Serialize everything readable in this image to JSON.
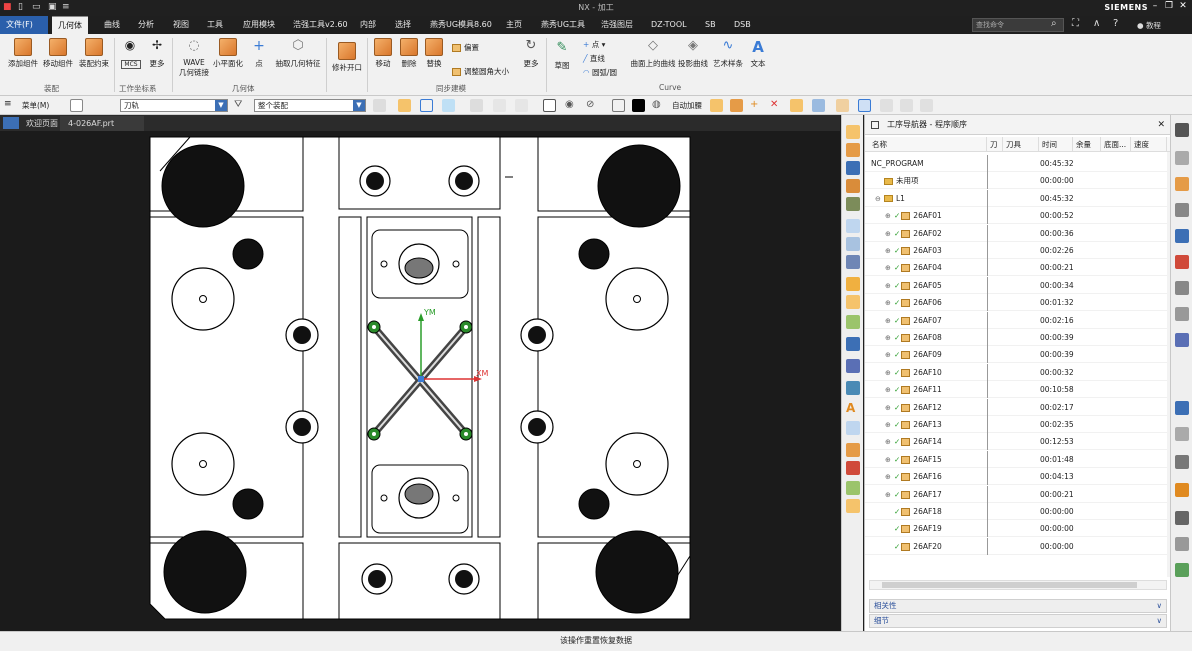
{
  "window": {
    "title": "NX - 加工",
    "brand": "SIEMENS"
  },
  "tabs": [
    {
      "label": "文件(F)"
    },
    {
      "label": "几何体"
    },
    {
      "label": "曲线"
    },
    {
      "label": "分析"
    },
    {
      "label": "视图"
    },
    {
      "label": "工具"
    },
    {
      "label": "应用模块"
    },
    {
      "label": "浩强工具v2.60"
    },
    {
      "label": "内部"
    },
    {
      "label": "选择"
    },
    {
      "label": "燕秀UG模具8.60"
    },
    {
      "label": "主页"
    },
    {
      "label": "燕秀UG工具"
    },
    {
      "label": "浩强图层"
    },
    {
      "label": "DZ-TOOL"
    },
    {
      "label": "SB"
    },
    {
      "label": "DSB"
    }
  ],
  "search": {
    "placeholder": "查找命令"
  },
  "user": {
    "label": "教程"
  },
  "ribbon": {
    "add_component": "添加组件",
    "move_component": "移动组件",
    "assembly_constraints": "装配约束",
    "group_assembly": "装配",
    "more1": "更多",
    "mcs": "MCS",
    "group_wcs": "工作坐标系",
    "wave_line1": "WAVE",
    "wave_line2": "几何链接",
    "small_planar": "小平面化",
    "point": "点",
    "extract_geom": "抽取几何特征",
    "group_geometry": "几何体",
    "patch_opening": "修补开口",
    "move": "移动",
    "delete": "删除",
    "replace": "替换",
    "offset": "偏置",
    "resize_blend": "调整圆角大小",
    "more2": "更多",
    "group_sync": "同步建模",
    "sketch": "草图",
    "point2": "点",
    "line": "直线",
    "arc": "圆弧/圆",
    "curve_on_surface": "曲面上的曲线",
    "project_curve": "投影曲线",
    "studio_spline": "艺术样条",
    "text": "文本",
    "group_curve": "Curve"
  },
  "toolbar2": {
    "menu": "菜单(M)",
    "filter_value": "刀轨",
    "scope_value": "整个装配",
    "auto_judge": "自动加腰"
  },
  "doc_tabs": [
    {
      "label": "欢迎页面"
    },
    {
      "label": "4-026AF.prt"
    }
  ],
  "axes": {
    "y": "YM",
    "x": "XM"
  },
  "navigator": {
    "title": "工序导航器 - 程序顺序",
    "columns": [
      "名称",
      "刀",
      "刀具",
      "时间",
      "余量",
      "底面...",
      "速度"
    ],
    "rows": [
      {
        "name": "NC_PROGRAM",
        "time": "00:45:32",
        "level": 0,
        "type": "root"
      },
      {
        "name": "未用项",
        "time": "00:00:00",
        "level": 1,
        "type": "folder"
      },
      {
        "name": "L1",
        "time": "00:45:32",
        "level": 1,
        "type": "folder"
      },
      {
        "name": "26AF01",
        "time": "00:00:52",
        "level": 2,
        "type": "op"
      },
      {
        "name": "26AF02",
        "time": "00:00:36",
        "level": 2,
        "type": "op"
      },
      {
        "name": "26AF03",
        "time": "00:02:26",
        "level": 2,
        "type": "op"
      },
      {
        "name": "26AF04",
        "time": "00:00:21",
        "level": 2,
        "type": "op"
      },
      {
        "name": "26AF05",
        "time": "00:00:34",
        "level": 2,
        "type": "op"
      },
      {
        "name": "26AF06",
        "time": "00:01:32",
        "level": 2,
        "type": "op"
      },
      {
        "name": "26AF07",
        "time": "00:02:16",
        "level": 2,
        "type": "op"
      },
      {
        "name": "26AF08",
        "time": "00:00:39",
        "level": 2,
        "type": "op"
      },
      {
        "name": "26AF09",
        "time": "00:00:39",
        "level": 2,
        "type": "op"
      },
      {
        "name": "26AF10",
        "time": "00:00:32",
        "level": 2,
        "type": "op"
      },
      {
        "name": "26AF11",
        "time": "00:10:58",
        "level": 2,
        "type": "op"
      },
      {
        "name": "26AF12",
        "time": "00:02:17",
        "level": 2,
        "type": "op"
      },
      {
        "name": "26AF13",
        "time": "00:02:35",
        "level": 2,
        "type": "op"
      },
      {
        "name": "26AF14",
        "time": "00:12:53",
        "level": 2,
        "type": "op"
      },
      {
        "name": "26AF15",
        "time": "00:01:48",
        "level": 2,
        "type": "op"
      },
      {
        "name": "26AF16",
        "time": "00:04:13",
        "level": 2,
        "type": "op"
      },
      {
        "name": "26AF17",
        "time": "00:00:21",
        "level": 2,
        "type": "op"
      },
      {
        "name": "26AF18",
        "time": "00:00:00",
        "level": 2,
        "type": "op"
      },
      {
        "name": "26AF19",
        "time": "00:00:00",
        "level": 2,
        "type": "op"
      },
      {
        "name": "26AF20",
        "time": "00:00:00",
        "level": 2,
        "type": "op"
      }
    ],
    "panel_related": "相关性",
    "panel_details": "细节"
  },
  "status": {
    "message": "该操作重置恢复数据"
  },
  "colors": {
    "accent": "#2a5fab",
    "ribbon_bg": "#f1f1f1",
    "dark_bg": "#1f1f1f",
    "ok": "#2a9d2a"
  }
}
